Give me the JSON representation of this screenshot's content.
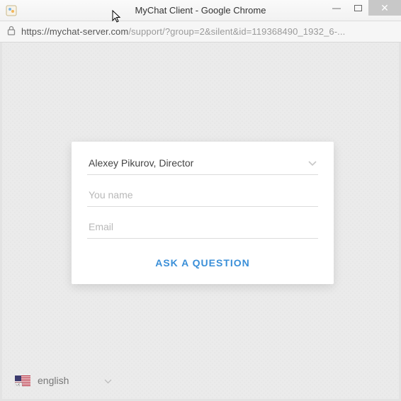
{
  "window": {
    "title": "MyChat Client - Google Chrome"
  },
  "address": {
    "host": "https://mychat-server.com",
    "path": "/support/?group=2&silent&id=119368490_1932_6-..."
  },
  "form": {
    "contact_selected": "Alexey Pikurov, Director",
    "name_placeholder": "You name",
    "email_placeholder": "Email",
    "submit_label": "ASK A QUESTION"
  },
  "language": {
    "label": "english"
  }
}
